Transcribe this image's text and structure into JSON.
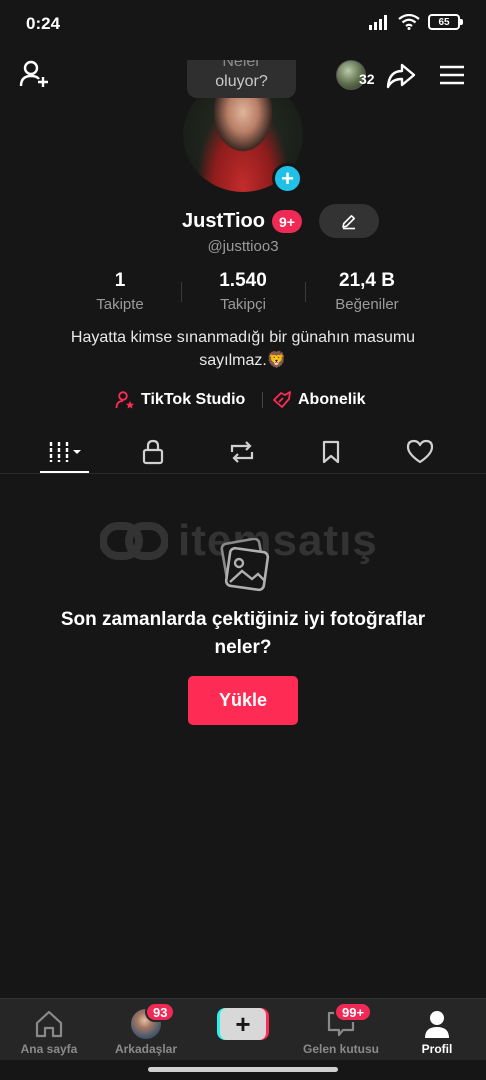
{
  "status_bar": {
    "time": "0:24",
    "battery": "65"
  },
  "top_nav": {
    "visitor_count": "32"
  },
  "profile": {
    "status_bubble_ghost": "Neler",
    "status_bubble": "oluyor?",
    "name": "JustTioo",
    "name_badge": "9+",
    "handle": "@justtioo3",
    "stats": [
      {
        "value": "1",
        "label": "Takipte"
      },
      {
        "value": "1.540",
        "label": "Takipçi"
      },
      {
        "value": "21,4 B",
        "label": "Beğeniler"
      }
    ],
    "bio_line1": "Hayatta kimse sınanmadığı bir günahın masumu",
    "bio_line2": "sayılmaz.🦁",
    "links": {
      "studio": "TikTok Studio",
      "subscription": "Abonelik"
    }
  },
  "tabs": [
    "videos-grid",
    "private-lock",
    "reposts",
    "favorites",
    "liked"
  ],
  "empty_state": {
    "watermark": "itemsatış",
    "title": "Son zamanlarda çektiğiniz iyi fotoğraflar neler?",
    "button": "Yükle"
  },
  "bottom_nav": {
    "home": "Ana sayfa",
    "friends": "Arkadaşlar",
    "friends_badge": "93",
    "inbox": "Gelen kutusu",
    "inbox_badge": "99+",
    "profile": "Profil"
  },
  "colors": {
    "accent": "#fe2c55",
    "badge": "#ef2a56",
    "cyan": "#25f4ee",
    "plus_blue": "#20c0e8",
    "background": "#161616"
  }
}
